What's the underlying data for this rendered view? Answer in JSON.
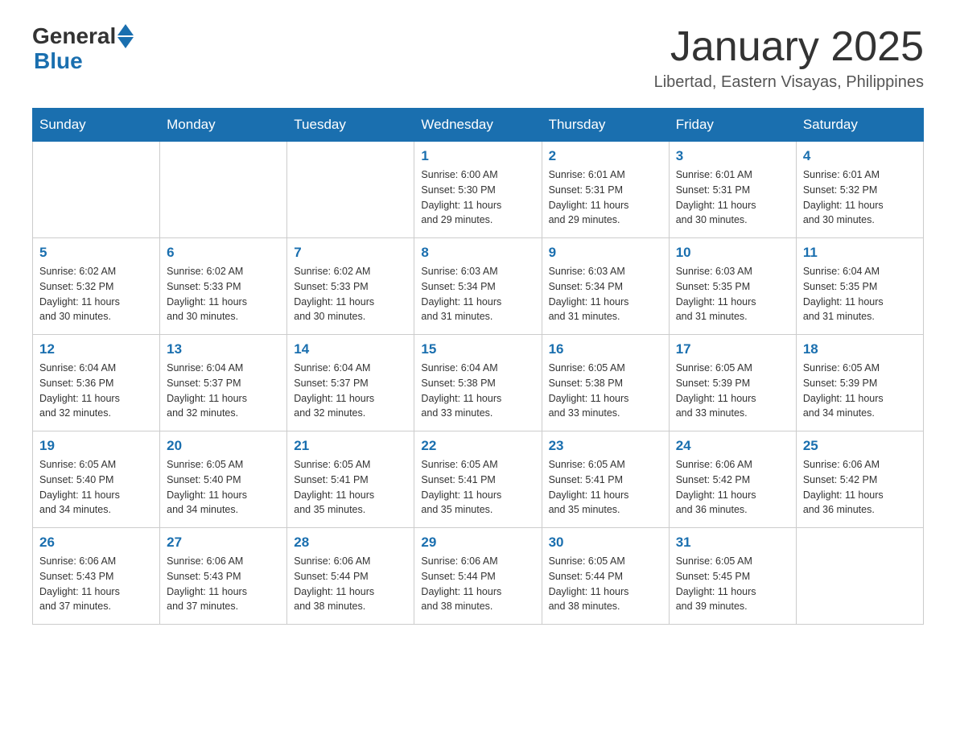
{
  "header": {
    "logo_general": "General",
    "logo_blue": "Blue",
    "month_title": "January 2025",
    "location": "Libertad, Eastern Visayas, Philippines"
  },
  "days_of_week": [
    "Sunday",
    "Monday",
    "Tuesday",
    "Wednesday",
    "Thursday",
    "Friday",
    "Saturday"
  ],
  "weeks": [
    [
      {
        "day": "",
        "info": ""
      },
      {
        "day": "",
        "info": ""
      },
      {
        "day": "",
        "info": ""
      },
      {
        "day": "1",
        "info": "Sunrise: 6:00 AM\nSunset: 5:30 PM\nDaylight: 11 hours\nand 29 minutes."
      },
      {
        "day": "2",
        "info": "Sunrise: 6:01 AM\nSunset: 5:31 PM\nDaylight: 11 hours\nand 29 minutes."
      },
      {
        "day": "3",
        "info": "Sunrise: 6:01 AM\nSunset: 5:31 PM\nDaylight: 11 hours\nand 30 minutes."
      },
      {
        "day": "4",
        "info": "Sunrise: 6:01 AM\nSunset: 5:32 PM\nDaylight: 11 hours\nand 30 minutes."
      }
    ],
    [
      {
        "day": "5",
        "info": "Sunrise: 6:02 AM\nSunset: 5:32 PM\nDaylight: 11 hours\nand 30 minutes."
      },
      {
        "day": "6",
        "info": "Sunrise: 6:02 AM\nSunset: 5:33 PM\nDaylight: 11 hours\nand 30 minutes."
      },
      {
        "day": "7",
        "info": "Sunrise: 6:02 AM\nSunset: 5:33 PM\nDaylight: 11 hours\nand 30 minutes."
      },
      {
        "day": "8",
        "info": "Sunrise: 6:03 AM\nSunset: 5:34 PM\nDaylight: 11 hours\nand 31 minutes."
      },
      {
        "day": "9",
        "info": "Sunrise: 6:03 AM\nSunset: 5:34 PM\nDaylight: 11 hours\nand 31 minutes."
      },
      {
        "day": "10",
        "info": "Sunrise: 6:03 AM\nSunset: 5:35 PM\nDaylight: 11 hours\nand 31 minutes."
      },
      {
        "day": "11",
        "info": "Sunrise: 6:04 AM\nSunset: 5:35 PM\nDaylight: 11 hours\nand 31 minutes."
      }
    ],
    [
      {
        "day": "12",
        "info": "Sunrise: 6:04 AM\nSunset: 5:36 PM\nDaylight: 11 hours\nand 32 minutes."
      },
      {
        "day": "13",
        "info": "Sunrise: 6:04 AM\nSunset: 5:37 PM\nDaylight: 11 hours\nand 32 minutes."
      },
      {
        "day": "14",
        "info": "Sunrise: 6:04 AM\nSunset: 5:37 PM\nDaylight: 11 hours\nand 32 minutes."
      },
      {
        "day": "15",
        "info": "Sunrise: 6:04 AM\nSunset: 5:38 PM\nDaylight: 11 hours\nand 33 minutes."
      },
      {
        "day": "16",
        "info": "Sunrise: 6:05 AM\nSunset: 5:38 PM\nDaylight: 11 hours\nand 33 minutes."
      },
      {
        "day": "17",
        "info": "Sunrise: 6:05 AM\nSunset: 5:39 PM\nDaylight: 11 hours\nand 33 minutes."
      },
      {
        "day": "18",
        "info": "Sunrise: 6:05 AM\nSunset: 5:39 PM\nDaylight: 11 hours\nand 34 minutes."
      }
    ],
    [
      {
        "day": "19",
        "info": "Sunrise: 6:05 AM\nSunset: 5:40 PM\nDaylight: 11 hours\nand 34 minutes."
      },
      {
        "day": "20",
        "info": "Sunrise: 6:05 AM\nSunset: 5:40 PM\nDaylight: 11 hours\nand 34 minutes."
      },
      {
        "day": "21",
        "info": "Sunrise: 6:05 AM\nSunset: 5:41 PM\nDaylight: 11 hours\nand 35 minutes."
      },
      {
        "day": "22",
        "info": "Sunrise: 6:05 AM\nSunset: 5:41 PM\nDaylight: 11 hours\nand 35 minutes."
      },
      {
        "day": "23",
        "info": "Sunrise: 6:05 AM\nSunset: 5:41 PM\nDaylight: 11 hours\nand 35 minutes."
      },
      {
        "day": "24",
        "info": "Sunrise: 6:06 AM\nSunset: 5:42 PM\nDaylight: 11 hours\nand 36 minutes."
      },
      {
        "day": "25",
        "info": "Sunrise: 6:06 AM\nSunset: 5:42 PM\nDaylight: 11 hours\nand 36 minutes."
      }
    ],
    [
      {
        "day": "26",
        "info": "Sunrise: 6:06 AM\nSunset: 5:43 PM\nDaylight: 11 hours\nand 37 minutes."
      },
      {
        "day": "27",
        "info": "Sunrise: 6:06 AM\nSunset: 5:43 PM\nDaylight: 11 hours\nand 37 minutes."
      },
      {
        "day": "28",
        "info": "Sunrise: 6:06 AM\nSunset: 5:44 PM\nDaylight: 11 hours\nand 38 minutes."
      },
      {
        "day": "29",
        "info": "Sunrise: 6:06 AM\nSunset: 5:44 PM\nDaylight: 11 hours\nand 38 minutes."
      },
      {
        "day": "30",
        "info": "Sunrise: 6:05 AM\nSunset: 5:44 PM\nDaylight: 11 hours\nand 38 minutes."
      },
      {
        "day": "31",
        "info": "Sunrise: 6:05 AM\nSunset: 5:45 PM\nDaylight: 11 hours\nand 39 minutes."
      },
      {
        "day": "",
        "info": ""
      }
    ]
  ]
}
